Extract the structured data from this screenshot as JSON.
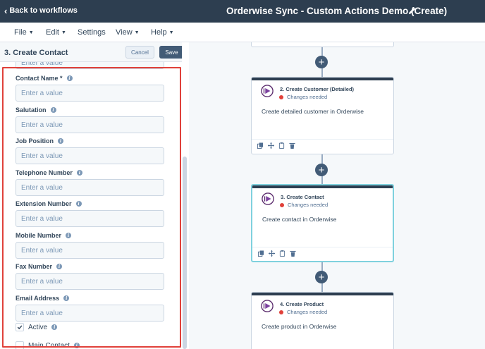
{
  "header": {
    "back_label": "Back to workflows",
    "workflow_title": "Orderwise Sync - Custom Actions Demo (Create)"
  },
  "menu": [
    {
      "label": "File",
      "has_caret": true
    },
    {
      "label": "Edit",
      "has_caret": true
    },
    {
      "label": "Settings",
      "has_caret": false
    },
    {
      "label": "View",
      "has_caret": true
    },
    {
      "label": "Help",
      "has_caret": true
    }
  ],
  "panel": {
    "title": "3. Create Contact",
    "cancel_label": "Cancel",
    "save_label": "Save",
    "clipped_input_placeholder": "Enter a value",
    "fields": [
      {
        "label": "Contact Name *",
        "placeholder": "Enter a value"
      },
      {
        "label": "Salutation",
        "placeholder": "Enter a value"
      },
      {
        "label": "Job Position",
        "placeholder": "Enter a value"
      },
      {
        "label": "Telephone Number",
        "placeholder": "Enter a value"
      },
      {
        "label": "Extension Number",
        "placeholder": "Enter a value"
      },
      {
        "label": "Mobile Number",
        "placeholder": "Enter a value"
      },
      {
        "label": "Fax Number",
        "placeholder": "Enter a value"
      },
      {
        "label": "Email Address",
        "placeholder": "Enter a value"
      }
    ],
    "checkboxes": [
      {
        "label": "Active",
        "checked": true
      },
      {
        "label": "Main Contact",
        "checked": false
      }
    ]
  },
  "workflow": {
    "cards": [
      {
        "title": "2. Create Customer (Detailed)",
        "status": "Changes needed",
        "description": "Create detailed customer in Orderwise",
        "selected": false
      },
      {
        "title": "3. Create Contact",
        "status": "Changes needed",
        "description": "Create contact in Orderwise",
        "selected": true
      },
      {
        "title": "4. Create Product",
        "status": "Changes needed",
        "description": "Create product in Orderwise",
        "selected": false
      }
    ],
    "add_action_glyph": "+"
  },
  "colors": {
    "topbar": "#2d3e50",
    "highlight_outline": "#e0413a",
    "selected_card_border": "#7fd1de",
    "status_dot": "#e0413a",
    "save_button": "#425b76"
  },
  "icons": {
    "back": "chevron-left-icon",
    "edit_title": "pencil-icon",
    "field_help": "info-icon",
    "card_app": "app-logo-icon",
    "card_tools": [
      "copy-icon",
      "move-icon",
      "clone-icon",
      "delete-icon"
    ]
  }
}
